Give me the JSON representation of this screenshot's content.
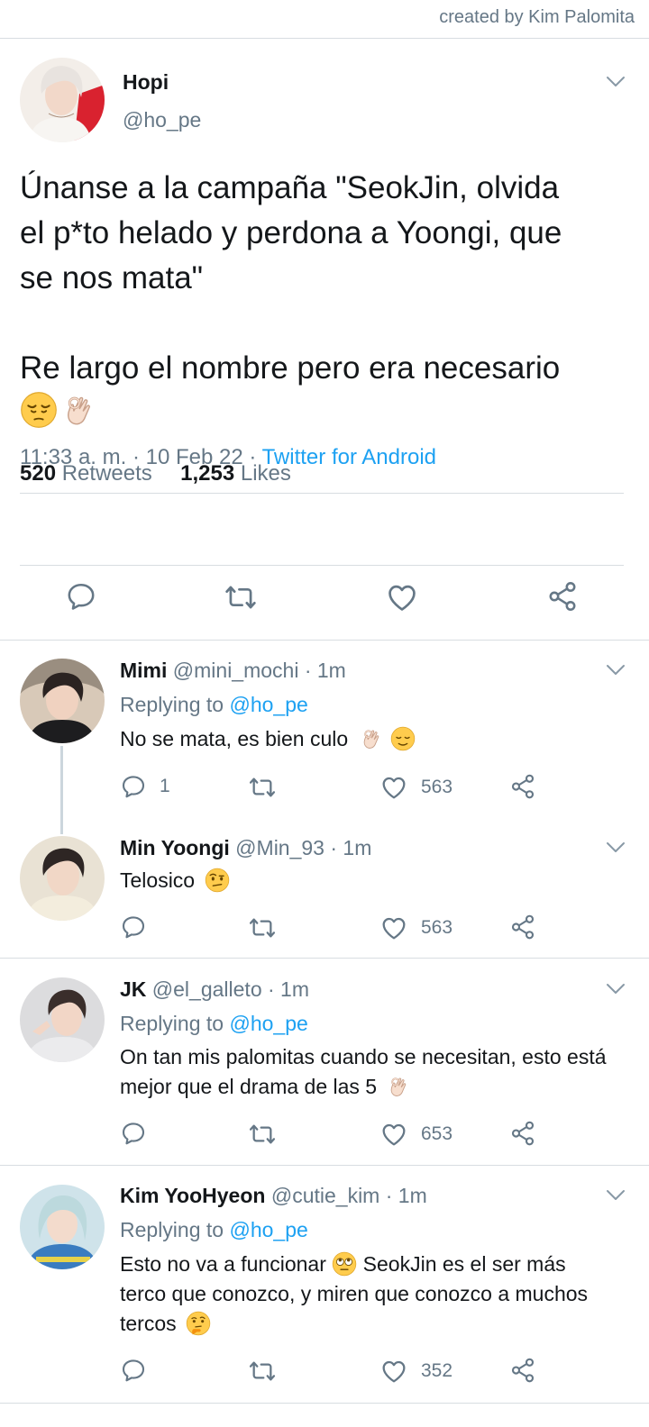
{
  "credit": "created by Kim Palomita",
  "colors": {
    "accent": "#1da1f2",
    "muted": "#657786",
    "text": "#14171a",
    "divider": "#d8dde1"
  },
  "main": {
    "name": "Hopi",
    "handle": "@ho_pe",
    "text": "Únanse a la campaña \"SeokJin, olvida\nel p*to helado y perdona a Yoongi, que\nse nos mata\"\n\nRe largo el nombre pero era necesario",
    "emojis": [
      "pensive-face-emoji",
      "ok-hand-emoji"
    ],
    "time": "11:33 a. m. · 10 Feb 22 · ",
    "source": "Twitter for Android",
    "retweets_count": "520",
    "retweets_label": " Retweets",
    "likes_count": "1,253",
    "likes_label": " Likes"
  },
  "replies": [
    {
      "name": "Mimi",
      "handle": " @mini_mochi · 1m",
      "replying_prefix": "Replying to ",
      "replying_to": "@ho_pe",
      "text": "No se mata, es bien culo",
      "emojis": [
        "ok-hand-emoji",
        "relieved-face-emoji"
      ],
      "reply_count": "1",
      "like_count": "563"
    },
    {
      "name": "Min Yoongi",
      "handle": " @Min_93 · 1m",
      "text": "Telosico",
      "emojis": [
        "face-with-raised-eyebrow-emoji"
      ],
      "reply_count": "",
      "like_count": "563"
    },
    {
      "name": "JK",
      "handle": " @el_galleto · 1m",
      "replying_prefix": "Replying to ",
      "replying_to": "@ho_pe",
      "text": "On tan mis palomitas cuando se necesitan, esto está mejor que el drama de las 5",
      "emojis": [
        "ok-hand-emoji"
      ],
      "reply_count": "",
      "like_count": "653"
    },
    {
      "name": "Kim YooHyeon",
      "handle": " @cutie_kim · 1m",
      "replying_prefix": "Replying to ",
      "replying_to": "@ho_pe",
      "text_a": "Esto no va a funcionar",
      "text_b": " SeokJin es el ser más terco que conozco, y miren que conozco a muchos tercos",
      "emojis": [
        "face-with-rolling-eyes-emoji",
        "thinking-face-emoji"
      ],
      "reply_count": "",
      "like_count": "352"
    }
  ]
}
